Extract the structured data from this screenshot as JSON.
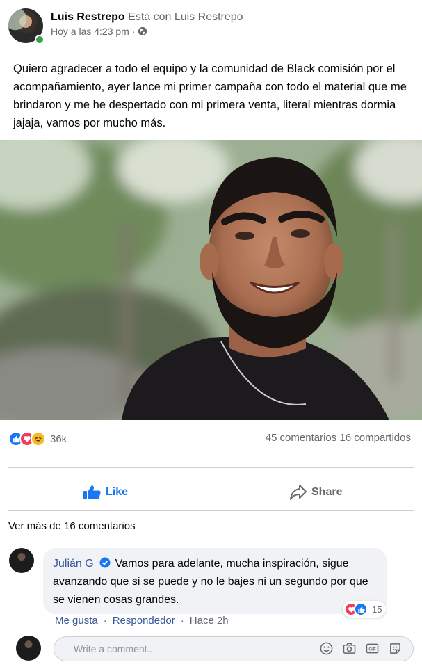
{
  "post": {
    "author": "Luis Restrepo",
    "with_text": "Esta con Luis Restrepo",
    "timestamp": "Hoy a las 4:23 pm ·",
    "privacy_icon": "globe-icon",
    "text": "Quiero agradecer a todo el equipo y la comunidad de Black comisión por el acompañamiento, ayer lance mi primer campaña con todo el material que me brindaron y me he despertado con mi primera venta, literal mientras dormia jajaja, vamos por mucho más.",
    "photo_alt": "photo-of-smiling-bearded-man"
  },
  "reactions": {
    "types": [
      "like",
      "love",
      "haha"
    ],
    "count": "36k",
    "comments": "45 comentarios",
    "shares": "16 compartidos"
  },
  "actions": {
    "like_label": "Like",
    "share_label": "Share"
  },
  "comments": {
    "more_label": "Ver más de 16 comentarios",
    "items": [
      {
        "author": "Julián G",
        "verified": true,
        "text": "Vamos para adelante, mucha inspiración, sigue avanzando que si se puede y no le bajes ni un segundo por que se vienen cosas grandes.",
        "reaction_count": "15",
        "like_label": "Me gusta",
        "reply_label": "Respondedor",
        "time": "Hace 2h"
      }
    ]
  },
  "composer": {
    "placeholder": "Write a comment..."
  },
  "colors": {
    "facebook_blue": "#1877f2",
    "link_blue": "#385898",
    "secondary_text": "#65676b",
    "bubble_bg": "#f0f2f5",
    "online_green": "#31a24c"
  }
}
